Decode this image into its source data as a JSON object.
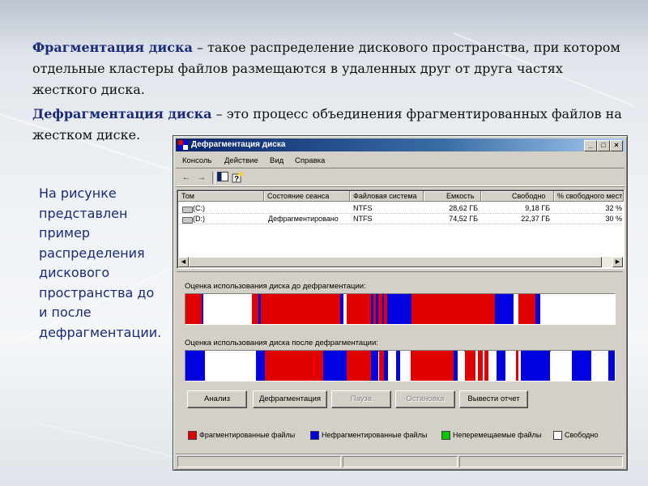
{
  "slide": {
    "para1_term": "Фрагментация диска",
    "para1_text": " – такое распределение дискового пространства, при котором отдельные кластеры файлов размещаются в удаленных друг от друга частях жесткого диска.",
    "para2_term": "Дефрагментация диска",
    "para2_text": " – это процесс объединения фрагментированных файлов на жестком диске.",
    "side_text": "На рисунке представлен пример распределения дискового пространства до и после дефрагментации."
  },
  "window": {
    "title": "Дефрагментация диска",
    "controls": {
      "minimize": "_",
      "maximize": "□",
      "close": "×"
    },
    "menu": [
      {
        "label": "Консоль"
      },
      {
        "label": "Действие"
      },
      {
        "label": "Вид"
      },
      {
        "label": "Справка"
      }
    ],
    "toolbar_icons": [
      "back-arrow-icon",
      "forward-arrow-icon",
      "console-tree-icon",
      "help-icon"
    ],
    "table": {
      "headers": [
        "Том",
        "Состояние сеанса",
        "Файловая система",
        "Емкость",
        "Свободно",
        "% свободного мест"
      ],
      "rows": [
        {
          "volume": "(C:)",
          "status": "",
          "fs": "NTFS",
          "capacity": "28,62 ГБ",
          "free": "9,18 ГБ",
          "pct": "32 %"
        },
        {
          "volume": "(D:)",
          "status": "Дефрагментировано",
          "fs": "NTFS",
          "capacity": "74,52 ГБ",
          "free": "22,37 ГБ",
          "pct": "30 %"
        }
      ]
    },
    "before_label": "Оценка использования диска до дефрагментации:",
    "after_label": "Оценка использования диска после дефрагментации:",
    "buttons": {
      "analyze": "Анализ",
      "defragment": "Дефрагментация",
      "pause": "Пауза",
      "stop": "Остановка",
      "report": "Вывести отчет"
    },
    "legend": {
      "fragmented": "Фрагментированные файлы",
      "contiguous": "Нефрагментированные файлы",
      "unmovable": "Неперемещаемые файлы",
      "free": "Свободно"
    },
    "colors": {
      "fragmented": "#e00000",
      "contiguous": "#0000e0",
      "unmovable": "#00c800",
      "free": "#ffffff"
    },
    "before_bar": [
      {
        "start": 0.0,
        "end": 0.037,
        "type": "fragmented"
      },
      {
        "start": 0.037,
        "end": 0.041,
        "type": "contiguous"
      },
      {
        "start": 0.041,
        "end": 0.155,
        "type": "free"
      },
      {
        "start": 0.155,
        "end": 0.17,
        "type": "fragmented"
      },
      {
        "start": 0.17,
        "end": 0.176,
        "type": "contiguous"
      },
      {
        "start": 0.176,
        "end": 0.36,
        "type": "fragmented"
      },
      {
        "start": 0.36,
        "end": 0.368,
        "type": "contiguous"
      },
      {
        "start": 0.368,
        "end": 0.375,
        "type": "free"
      },
      {
        "start": 0.375,
        "end": 0.432,
        "type": "fragmented"
      },
      {
        "start": 0.432,
        "end": 0.438,
        "type": "contiguous"
      },
      {
        "start": 0.438,
        "end": 0.444,
        "type": "fragmented"
      },
      {
        "start": 0.444,
        "end": 0.449,
        "type": "contiguous"
      },
      {
        "start": 0.449,
        "end": 0.458,
        "type": "fragmented"
      },
      {
        "start": 0.458,
        "end": 0.462,
        "type": "contiguous"
      },
      {
        "start": 0.462,
        "end": 0.47,
        "type": "fragmented"
      },
      {
        "start": 0.47,
        "end": 0.526,
        "type": "contiguous"
      },
      {
        "start": 0.526,
        "end": 0.72,
        "type": "fragmented"
      },
      {
        "start": 0.72,
        "end": 0.765,
        "type": "contiguous"
      },
      {
        "start": 0.765,
        "end": 0.775,
        "type": "free"
      },
      {
        "start": 0.775,
        "end": 0.815,
        "type": "fragmented"
      },
      {
        "start": 0.815,
        "end": 0.826,
        "type": "contiguous"
      },
      {
        "start": 0.826,
        "end": 1.0,
        "type": "free"
      }
    ],
    "after_bar": [
      {
        "start": 0.0,
        "end": 0.045,
        "type": "contiguous"
      },
      {
        "start": 0.045,
        "end": 0.165,
        "type": "free"
      },
      {
        "start": 0.165,
        "end": 0.185,
        "type": "contiguous"
      },
      {
        "start": 0.185,
        "end": 0.32,
        "type": "fragmented"
      },
      {
        "start": 0.32,
        "end": 0.375,
        "type": "contiguous"
      },
      {
        "start": 0.375,
        "end": 0.432,
        "type": "fragmented"
      },
      {
        "start": 0.432,
        "end": 0.45,
        "type": "contiguous"
      },
      {
        "start": 0.45,
        "end": 0.462,
        "type": "fragmented"
      },
      {
        "start": 0.462,
        "end": 0.472,
        "type": "contiguous"
      },
      {
        "start": 0.472,
        "end": 0.49,
        "type": "free"
      },
      {
        "start": 0.49,
        "end": 0.5,
        "type": "contiguous"
      },
      {
        "start": 0.5,
        "end": 0.525,
        "type": "free"
      },
      {
        "start": 0.525,
        "end": 0.625,
        "type": "fragmented"
      },
      {
        "start": 0.625,
        "end": 0.634,
        "type": "contiguous"
      },
      {
        "start": 0.634,
        "end": 0.65,
        "type": "free"
      },
      {
        "start": 0.65,
        "end": 0.676,
        "type": "fragmented"
      },
      {
        "start": 0.676,
        "end": 0.682,
        "type": "free"
      },
      {
        "start": 0.682,
        "end": 0.692,
        "type": "fragmented"
      },
      {
        "start": 0.692,
        "end": 0.697,
        "type": "free"
      },
      {
        "start": 0.697,
        "end": 0.705,
        "type": "fragmented"
      },
      {
        "start": 0.705,
        "end": 0.725,
        "type": "free"
      },
      {
        "start": 0.725,
        "end": 0.745,
        "type": "contiguous"
      },
      {
        "start": 0.745,
        "end": 0.77,
        "type": "free"
      },
      {
        "start": 0.77,
        "end": 0.776,
        "type": "fragmented"
      },
      {
        "start": 0.776,
        "end": 0.782,
        "type": "free"
      },
      {
        "start": 0.782,
        "end": 0.788,
        "type": "contiguous"
      },
      {
        "start": 0.788,
        "end": 0.85,
        "type": "contiguous"
      },
      {
        "start": 0.85,
        "end": 0.9,
        "type": "free"
      },
      {
        "start": 0.9,
        "end": 0.945,
        "type": "contiguous"
      },
      {
        "start": 0.945,
        "end": 0.985,
        "type": "free"
      },
      {
        "start": 0.985,
        "end": 1.0,
        "type": "contiguous"
      }
    ]
  }
}
